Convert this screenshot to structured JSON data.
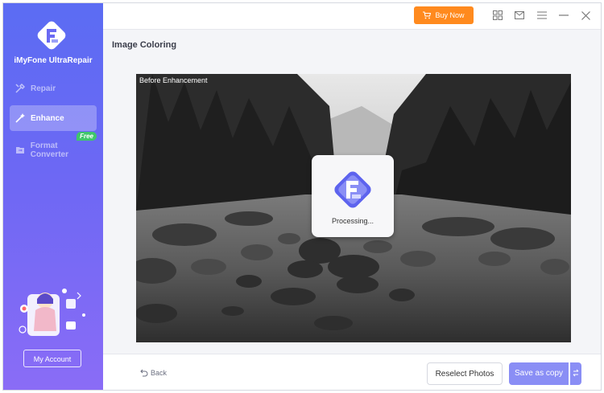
{
  "app": {
    "name": "iMyFone UltraRepair"
  },
  "sidebar": {
    "items": [
      {
        "label": "Repair",
        "icon": "tools-icon",
        "active": false
      },
      {
        "label": "Enhance",
        "icon": "magic-wand-icon",
        "active": true
      },
      {
        "label": "Format Converter",
        "icon": "folder-convert-icon",
        "active": false,
        "badge": "Free"
      }
    ],
    "account_label": "My Account"
  },
  "titlebar": {
    "buy_label": "Buy Now",
    "icons": [
      "grid-icon",
      "mail-icon",
      "menu-icon",
      "minimize-icon",
      "close-icon"
    ]
  },
  "main": {
    "title": "Image Coloring",
    "image_label": "Before Enhancement",
    "processing_text": "Processing..."
  },
  "bottombar": {
    "back_label": "Back",
    "reselect_label": "Reselect Photos",
    "save_label": "Save as copy"
  },
  "colors": {
    "sidebar_top": "#5b6cf3",
    "sidebar_bottom": "#8a6cf6",
    "buy_button": "#ff8a1e",
    "primary_button": "#8a8ef5",
    "free_badge": "#3fc66b"
  }
}
